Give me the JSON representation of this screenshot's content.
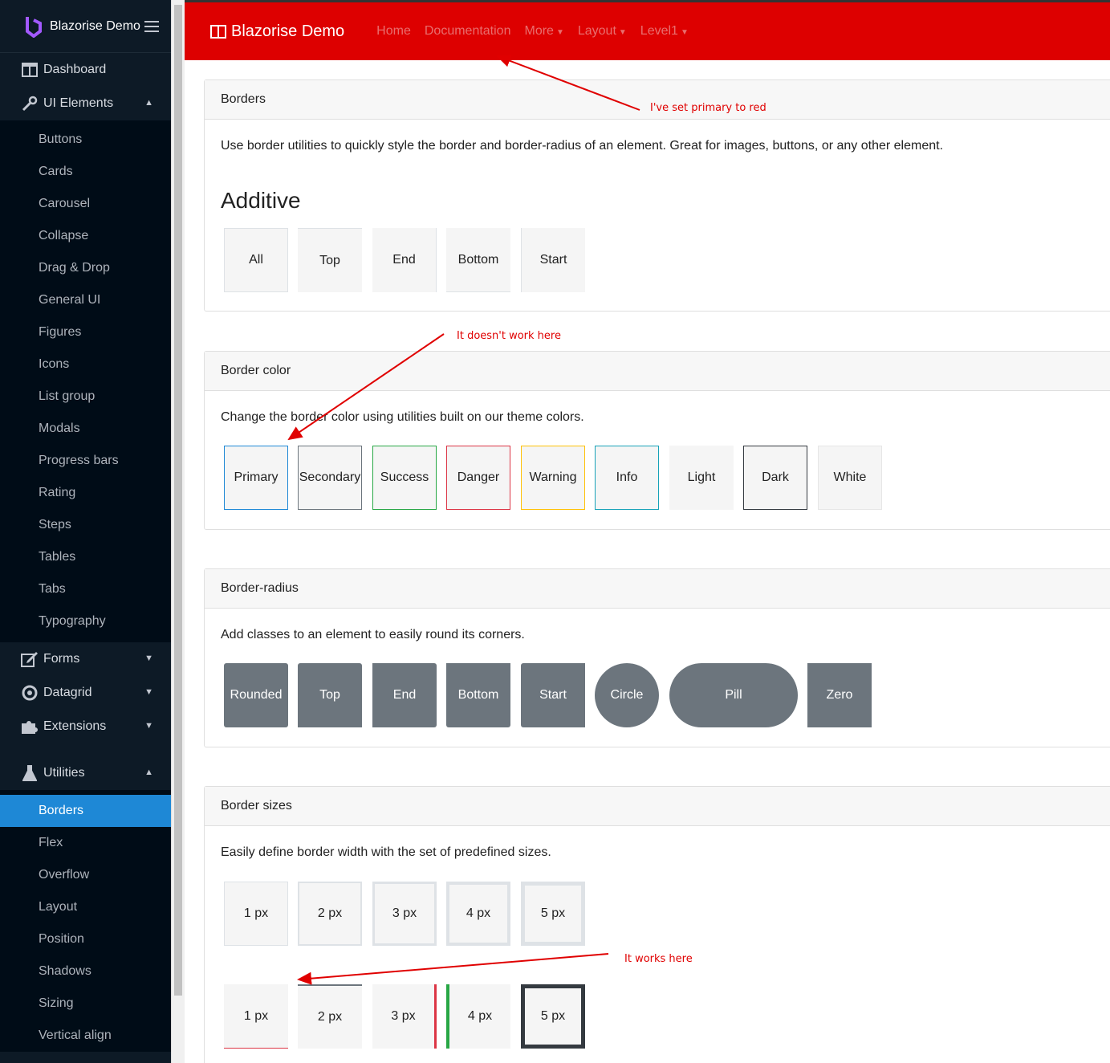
{
  "sidebar": {
    "brand": "Blazorise Demo",
    "dashboard": "Dashboard",
    "ui_elements": "UI Elements",
    "ui_items": [
      "Buttons",
      "Cards",
      "Carousel",
      "Collapse",
      "Drag & Drop",
      "General UI",
      "Figures",
      "Icons",
      "List group",
      "Modals",
      "Progress bars",
      "Rating",
      "Steps",
      "Tables",
      "Tabs",
      "Typography"
    ],
    "forms": "Forms",
    "datagrid": "Datagrid",
    "extensions": "Extensions",
    "utilities": "Utilities",
    "utility_items": [
      "Borders",
      "Flex",
      "Overflow",
      "Layout",
      "Position",
      "Shadows",
      "Sizing",
      "Vertical align"
    ]
  },
  "navbar": {
    "brand": "Blazorise Demo",
    "links": [
      "Home",
      "Documentation",
      "More",
      "Layout",
      "Level1"
    ]
  },
  "borders": {
    "header": "Borders",
    "text": "Use border utilities to quickly style the border and border-radius of an element. Great for images, buttons, or any other element.",
    "subheading": "Additive",
    "items": [
      "All",
      "Top",
      "End",
      "Bottom",
      "Start"
    ]
  },
  "border_color": {
    "header": "Border color",
    "text": "Change the border color using utilities built on our theme colors.",
    "items": [
      "Primary",
      "Secondary",
      "Success",
      "Danger",
      "Warning",
      "Info",
      "Light",
      "Dark",
      "White"
    ],
    "colors": [
      "#1e88d6",
      "#6c757d",
      "#28a745",
      "#dc3545",
      "#ffc107",
      "#17a2b8",
      "#f5f5f5",
      "#343a40",
      "#ffffff"
    ]
  },
  "border_radius": {
    "header": "Border-radius",
    "text": "Add classes to an element to easily round its corners.",
    "items": [
      "Rounded",
      "Top",
      "End",
      "Bottom",
      "Start",
      "Circle",
      "Pill",
      "Zero"
    ]
  },
  "border_sizes": {
    "header": "Border sizes",
    "text": "Easily define border width with the set of predefined sizes.",
    "row1": [
      "1 px",
      "2 px",
      "3 px",
      "4 px",
      "5 px"
    ],
    "row2": [
      "1 px",
      "2 px",
      "3 px",
      "4 px",
      "5 px"
    ]
  },
  "annotations": {
    "a1": "I've set primary to red",
    "a2": "It doesn't work here",
    "a3": "It works here"
  }
}
